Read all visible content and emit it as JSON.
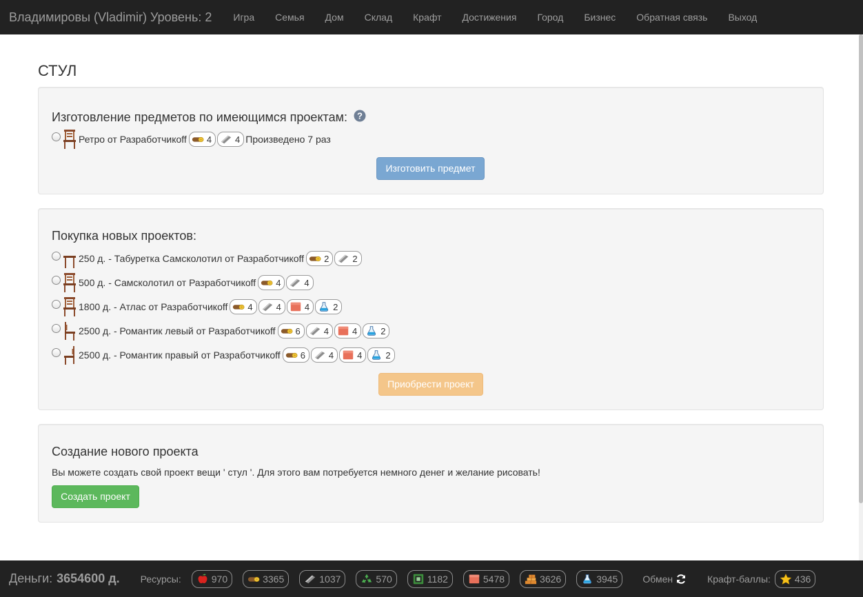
{
  "navbar": {
    "brand": "Владимировы (Vladimir) Уровень: 2",
    "items": [
      "Игра",
      "Семья",
      "Дом",
      "Склад",
      "Крафт",
      "Достижения",
      "Город",
      "Бизнес",
      "Обратная связь",
      "Выход"
    ]
  },
  "page_title": "СТУЛ",
  "craft": {
    "title": "Изготовление предметов по имеющимся проектам:",
    "help_icon": "question-circle-icon",
    "item": {
      "name": "Ретро от Разработчикоff",
      "resources": [
        {
          "icon": "wood-icon",
          "amount": "4"
        },
        {
          "icon": "metal-icon",
          "amount": "4"
        }
      ],
      "produced": "Произведено 7 раз"
    },
    "button": "Изготовить предмет"
  },
  "purchase": {
    "title": "Покупка новых проектов:",
    "projects": [
      {
        "label": "250 д. - Табуретка Самсколотил от Разработчикоff",
        "icon": "stool-icon",
        "resources": [
          {
            "icon": "wood-icon",
            "amount": "2"
          },
          {
            "icon": "metal-icon",
            "amount": "2"
          }
        ]
      },
      {
        "label": "500 д. - Самсколотил от Разработчикоff",
        "icon": "chair-icon",
        "resources": [
          {
            "icon": "wood-icon",
            "amount": "4"
          },
          {
            "icon": "metal-icon",
            "amount": "4"
          }
        ]
      },
      {
        "label": "1800 д. - Атлас от Разработчикоff",
        "icon": "chair-icon",
        "resources": [
          {
            "icon": "wood-icon",
            "amount": "4"
          },
          {
            "icon": "metal-icon",
            "amount": "4"
          },
          {
            "icon": "fabric-icon",
            "amount": "4"
          },
          {
            "icon": "chemistry-icon",
            "amount": "2"
          }
        ]
      },
      {
        "label": "2500 д. - Романтик левый от Разработчикоff",
        "icon": "chair-icon",
        "resources": [
          {
            "icon": "wood-icon",
            "amount": "6"
          },
          {
            "icon": "metal-icon",
            "amount": "4"
          },
          {
            "icon": "fabric-icon",
            "amount": "4"
          },
          {
            "icon": "chemistry-icon",
            "amount": "2"
          }
        ]
      },
      {
        "label": "2500 д. - Романтик правый от Разработчикоff",
        "icon": "chair-icon",
        "resources": [
          {
            "icon": "wood-icon",
            "amount": "6"
          },
          {
            "icon": "metal-icon",
            "amount": "4"
          },
          {
            "icon": "fabric-icon",
            "amount": "4"
          },
          {
            "icon": "chemistry-icon",
            "amount": "2"
          }
        ]
      }
    ],
    "button": "Приобрести проект"
  },
  "create": {
    "title": "Создание нового проекта",
    "text": "Вы можете создать свой проект вещи ' стул '. Для этого вам потребуется немного денег и желание рисовать!",
    "button": "Создать проект"
  },
  "footer": {
    "money_label": "Деньги:",
    "money_value": "3654600 д.",
    "resources_label": "Ресурсы:",
    "resources": [
      {
        "icon": "apple-icon",
        "amount": "970"
      },
      {
        "icon": "wood-icon",
        "amount": "3365"
      },
      {
        "icon": "metal-icon",
        "amount": "1037"
      },
      {
        "icon": "recycle-icon",
        "amount": "570"
      },
      {
        "icon": "electronics-icon",
        "amount": "1182"
      },
      {
        "icon": "fabric-icon",
        "amount": "5478"
      },
      {
        "icon": "bricks-icon",
        "amount": "3626"
      },
      {
        "icon": "chemistry-icon",
        "amount": "3945"
      }
    ],
    "exchange_label": "Обмен",
    "craft_points_label": "Крафт-баллы:",
    "craft_points": {
      "icon": "star-icon",
      "amount": "436"
    }
  },
  "colors": {
    "navbar_bg": "#222222",
    "nav_text": "#9d9d9d",
    "well_bg": "#f5f5f5",
    "primary": "#7aa7d2",
    "warning": "#f4c68a",
    "success": "#5cb85c"
  }
}
